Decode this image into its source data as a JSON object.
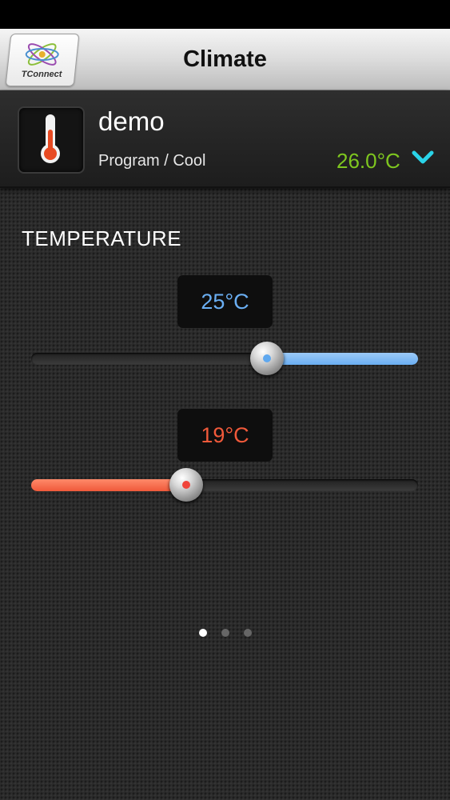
{
  "header": {
    "title": "Climate",
    "logo_text": "TConnect",
    "logo_icon": "atom-logo-icon"
  },
  "zone": {
    "name": "demo",
    "mode": "Program / Cool",
    "current_temp": "26.0°C",
    "thermometer_icon": "thermometer-icon",
    "expand_icon": "chevron-down-icon"
  },
  "temperature": {
    "section_title": "TEMPERATURE",
    "cool_setpoint": {
      "label": "25°C",
      "value": 25,
      "fraction": 0.61,
      "color": "#6aaef2"
    },
    "heat_setpoint": {
      "label": "19°C",
      "value": 19,
      "fraction": 0.4,
      "color": "#f0593a"
    }
  },
  "pagination": {
    "pages": 3,
    "current": 1
  },
  "colors": {
    "accent_green": "#7ec61f",
    "accent_cyan": "#2ad3e8"
  }
}
